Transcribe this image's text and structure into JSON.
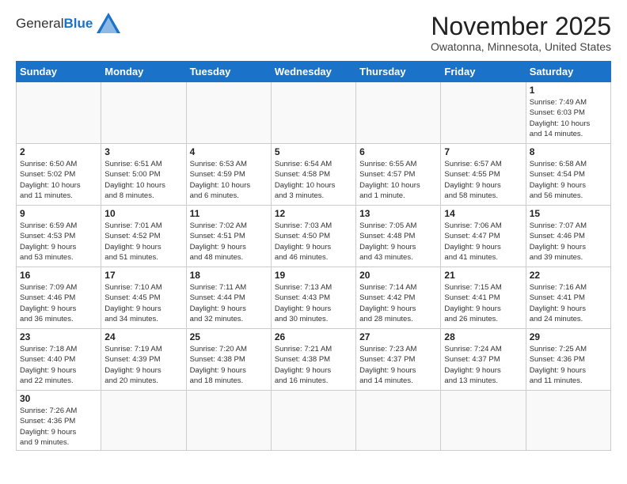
{
  "header": {
    "logo_general": "General",
    "logo_blue": "Blue",
    "month_title": "November 2025",
    "location": "Owatonna, Minnesota, United States"
  },
  "weekdays": [
    "Sunday",
    "Monday",
    "Tuesday",
    "Wednesday",
    "Thursday",
    "Friday",
    "Saturday"
  ],
  "weeks": [
    [
      {
        "day": "",
        "info": ""
      },
      {
        "day": "",
        "info": ""
      },
      {
        "day": "",
        "info": ""
      },
      {
        "day": "",
        "info": ""
      },
      {
        "day": "",
        "info": ""
      },
      {
        "day": "",
        "info": ""
      },
      {
        "day": "1",
        "info": "Sunrise: 7:49 AM\nSunset: 6:03 PM\nDaylight: 10 hours\nand 14 minutes."
      }
    ],
    [
      {
        "day": "2",
        "info": "Sunrise: 6:50 AM\nSunset: 5:02 PM\nDaylight: 10 hours\nand 11 minutes."
      },
      {
        "day": "3",
        "info": "Sunrise: 6:51 AM\nSunset: 5:00 PM\nDaylight: 10 hours\nand 8 minutes."
      },
      {
        "day": "4",
        "info": "Sunrise: 6:53 AM\nSunset: 4:59 PM\nDaylight: 10 hours\nand 6 minutes."
      },
      {
        "day": "5",
        "info": "Sunrise: 6:54 AM\nSunset: 4:58 PM\nDaylight: 10 hours\nand 3 minutes."
      },
      {
        "day": "6",
        "info": "Sunrise: 6:55 AM\nSunset: 4:57 PM\nDaylight: 10 hours\nand 1 minute."
      },
      {
        "day": "7",
        "info": "Sunrise: 6:57 AM\nSunset: 4:55 PM\nDaylight: 9 hours\nand 58 minutes."
      },
      {
        "day": "8",
        "info": "Sunrise: 6:58 AM\nSunset: 4:54 PM\nDaylight: 9 hours\nand 56 minutes."
      }
    ],
    [
      {
        "day": "9",
        "info": "Sunrise: 6:59 AM\nSunset: 4:53 PM\nDaylight: 9 hours\nand 53 minutes."
      },
      {
        "day": "10",
        "info": "Sunrise: 7:01 AM\nSunset: 4:52 PM\nDaylight: 9 hours\nand 51 minutes."
      },
      {
        "day": "11",
        "info": "Sunrise: 7:02 AM\nSunset: 4:51 PM\nDaylight: 9 hours\nand 48 minutes."
      },
      {
        "day": "12",
        "info": "Sunrise: 7:03 AM\nSunset: 4:50 PM\nDaylight: 9 hours\nand 46 minutes."
      },
      {
        "day": "13",
        "info": "Sunrise: 7:05 AM\nSunset: 4:48 PM\nDaylight: 9 hours\nand 43 minutes."
      },
      {
        "day": "14",
        "info": "Sunrise: 7:06 AM\nSunset: 4:47 PM\nDaylight: 9 hours\nand 41 minutes."
      },
      {
        "day": "15",
        "info": "Sunrise: 7:07 AM\nSunset: 4:46 PM\nDaylight: 9 hours\nand 39 minutes."
      }
    ],
    [
      {
        "day": "16",
        "info": "Sunrise: 7:09 AM\nSunset: 4:46 PM\nDaylight: 9 hours\nand 36 minutes."
      },
      {
        "day": "17",
        "info": "Sunrise: 7:10 AM\nSunset: 4:45 PM\nDaylight: 9 hours\nand 34 minutes."
      },
      {
        "day": "18",
        "info": "Sunrise: 7:11 AM\nSunset: 4:44 PM\nDaylight: 9 hours\nand 32 minutes."
      },
      {
        "day": "19",
        "info": "Sunrise: 7:13 AM\nSunset: 4:43 PM\nDaylight: 9 hours\nand 30 minutes."
      },
      {
        "day": "20",
        "info": "Sunrise: 7:14 AM\nSunset: 4:42 PM\nDaylight: 9 hours\nand 28 minutes."
      },
      {
        "day": "21",
        "info": "Sunrise: 7:15 AM\nSunset: 4:41 PM\nDaylight: 9 hours\nand 26 minutes."
      },
      {
        "day": "22",
        "info": "Sunrise: 7:16 AM\nSunset: 4:41 PM\nDaylight: 9 hours\nand 24 minutes."
      }
    ],
    [
      {
        "day": "23",
        "info": "Sunrise: 7:18 AM\nSunset: 4:40 PM\nDaylight: 9 hours\nand 22 minutes."
      },
      {
        "day": "24",
        "info": "Sunrise: 7:19 AM\nSunset: 4:39 PM\nDaylight: 9 hours\nand 20 minutes."
      },
      {
        "day": "25",
        "info": "Sunrise: 7:20 AM\nSunset: 4:38 PM\nDaylight: 9 hours\nand 18 minutes."
      },
      {
        "day": "26",
        "info": "Sunrise: 7:21 AM\nSunset: 4:38 PM\nDaylight: 9 hours\nand 16 minutes."
      },
      {
        "day": "27",
        "info": "Sunrise: 7:23 AM\nSunset: 4:37 PM\nDaylight: 9 hours\nand 14 minutes."
      },
      {
        "day": "28",
        "info": "Sunrise: 7:24 AM\nSunset: 4:37 PM\nDaylight: 9 hours\nand 13 minutes."
      },
      {
        "day": "29",
        "info": "Sunrise: 7:25 AM\nSunset: 4:36 PM\nDaylight: 9 hours\nand 11 minutes."
      }
    ],
    [
      {
        "day": "30",
        "info": "Sunrise: 7:26 AM\nSunset: 4:36 PM\nDaylight: 9 hours\nand 9 minutes."
      },
      {
        "day": "",
        "info": ""
      },
      {
        "day": "",
        "info": ""
      },
      {
        "day": "",
        "info": ""
      },
      {
        "day": "",
        "info": ""
      },
      {
        "day": "",
        "info": ""
      },
      {
        "day": "",
        "info": ""
      }
    ]
  ]
}
